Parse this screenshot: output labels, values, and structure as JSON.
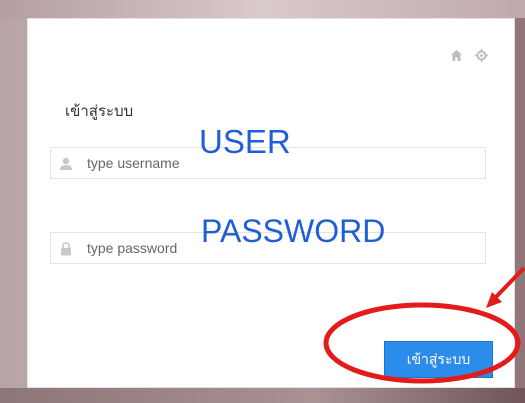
{
  "header": {
    "icons": [
      "home-icon",
      "gear-icon"
    ]
  },
  "form": {
    "title": "เข้าสู่ระบบ",
    "username_placeholder": "type username",
    "password_placeholder": "type password",
    "submit_label": "เข้าสู่ระบบ"
  },
  "annotations": {
    "user_label": "USER",
    "password_label": "PASSWORD",
    "text_color": "#1e5fd8",
    "highlight_color": "#e31b1b"
  },
  "colors": {
    "button_bg": "#2b8cea",
    "icon_gray": "#bdbdbd"
  }
}
